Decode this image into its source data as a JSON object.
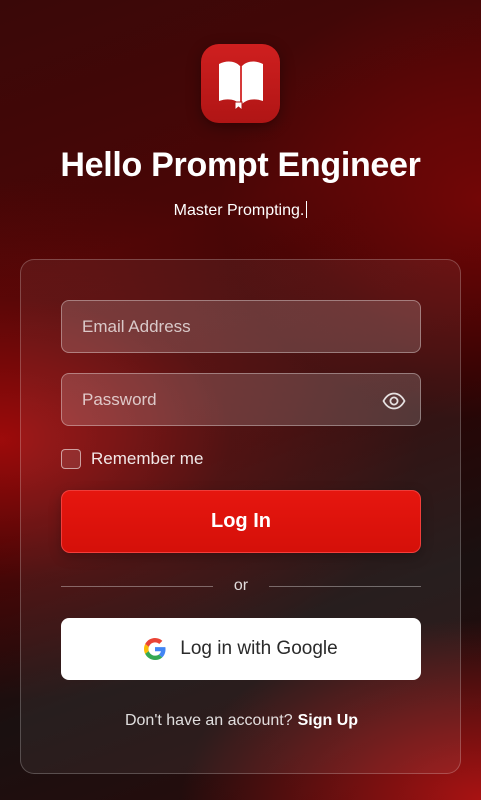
{
  "app": {
    "icon": "open-book-icon",
    "title": "Hello Prompt Engineer",
    "tagline": "Master Prompting."
  },
  "form": {
    "email": {
      "placeholder": "Email Address",
      "value": ""
    },
    "password": {
      "placeholder": "Password",
      "value": "",
      "toggle_icon": "eye-icon"
    },
    "remember_label": "Remember me",
    "remember_checked": false,
    "login_label": "Log In",
    "divider_text": "or",
    "google_label": "Log in with Google",
    "google_icon": "google-g-icon",
    "signup_prompt": "Don't have an account?",
    "signup_link": "Sign Up"
  },
  "colors": {
    "accent": "#E3140D",
    "icon_bg": "#C41A1A"
  }
}
